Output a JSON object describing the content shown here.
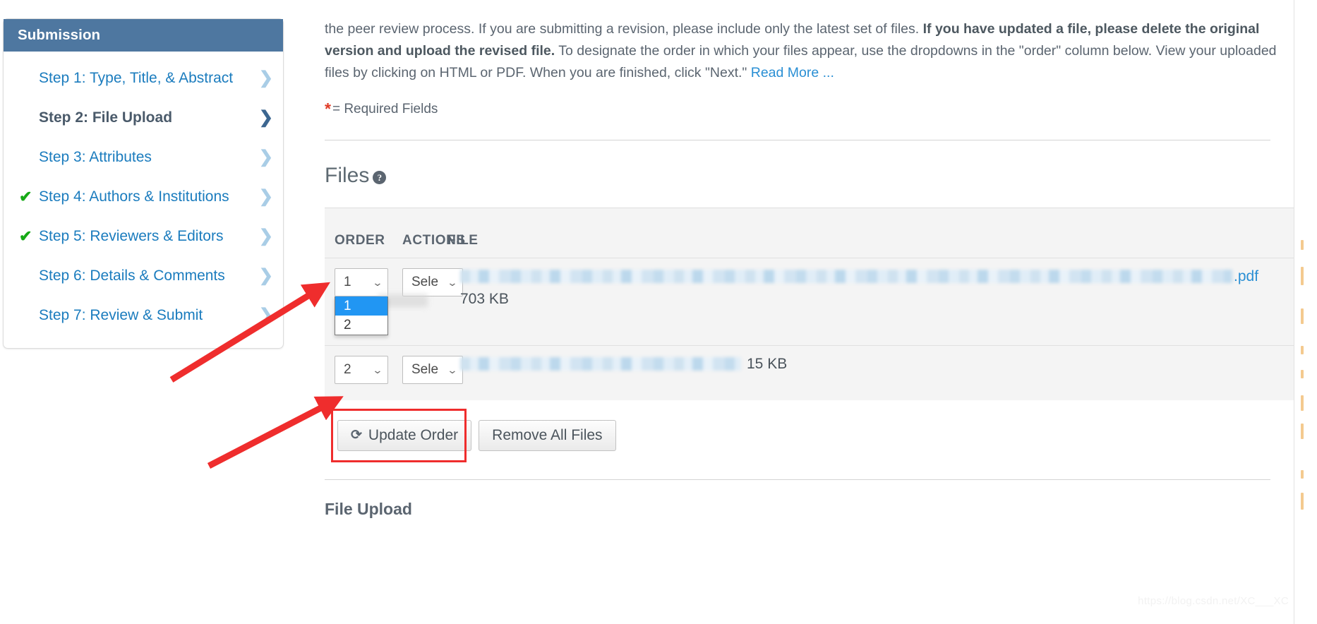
{
  "sidebar": {
    "header": "Submission",
    "items": [
      {
        "label": "Step 1: Type, Title, & Abstract",
        "completed": false,
        "active": false,
        "chevron": "❯"
      },
      {
        "label": "Step 2: File Upload",
        "completed": false,
        "active": true,
        "chevron": "❯"
      },
      {
        "label": "Step 3: Attributes",
        "completed": false,
        "active": false,
        "chevron": "❯"
      },
      {
        "label": "Step 4: Authors & Institutions",
        "completed": true,
        "active": false,
        "chevron": "❯"
      },
      {
        "label": "Step 5: Reviewers & Editors",
        "completed": true,
        "active": false,
        "chevron": "❯"
      },
      {
        "label": "Step 6: Details & Comments",
        "completed": false,
        "active": false,
        "chevron": "❯"
      },
      {
        "label": "Step 7: Review & Submit",
        "completed": false,
        "active": false,
        "chevron": "❯"
      }
    ],
    "check_glyph": "✔"
  },
  "intro": {
    "text_1": "the peer review process. If you are submitting a revision, please include only the latest set of files. ",
    "bold_1": "If you have updated a file, please delete the original version and upload the revised file.",
    "text_2": " To designate the order in which your files appear, use the dropdowns in the \"order\" column below. View your uploaded files by clicking on HTML or PDF. When you are finished, click \"Next.\" ",
    "read_more": "Read More ..."
  },
  "required_note": {
    "star": "*",
    "text": "= Required Fields"
  },
  "files_section": {
    "heading": "Files",
    "help_glyph": "?",
    "columns": {
      "order": "ORDER",
      "actions": "ACTIONS",
      "file": "FILE"
    },
    "rows": [
      {
        "order_value": "1",
        "order_options": [
          "1",
          "2"
        ],
        "order_selected": "1",
        "dropdown_open": true,
        "action_label": "Sele",
        "file_extension": ".pdf",
        "file_size": "703 KB",
        "size_inline": false
      },
      {
        "order_value": "2",
        "order_options": [
          "1",
          "2"
        ],
        "order_selected": "2",
        "dropdown_open": false,
        "action_label": "Sele",
        "file_extension": "",
        "file_size": "15 KB",
        "size_inline": true
      }
    ],
    "caret_glyph": "⌄"
  },
  "buttons": {
    "update_order": "Update Order",
    "update_order_icon": "⟳",
    "remove_all_files": "Remove All Files"
  },
  "file_upload_heading": "File Upload",
  "watermark": "https://blog.csdn.net/XC___XC",
  "colors": {
    "sidebar_header_bg": "#4e77a0",
    "link_blue": "#1b7cbe",
    "check_green": "#16a916",
    "highlight_red": "#ef2d2d",
    "arrow_red": "#ef2d2d",
    "table_bg": "#f4f4f4",
    "dropdown_selected_bg": "#2196f3"
  }
}
